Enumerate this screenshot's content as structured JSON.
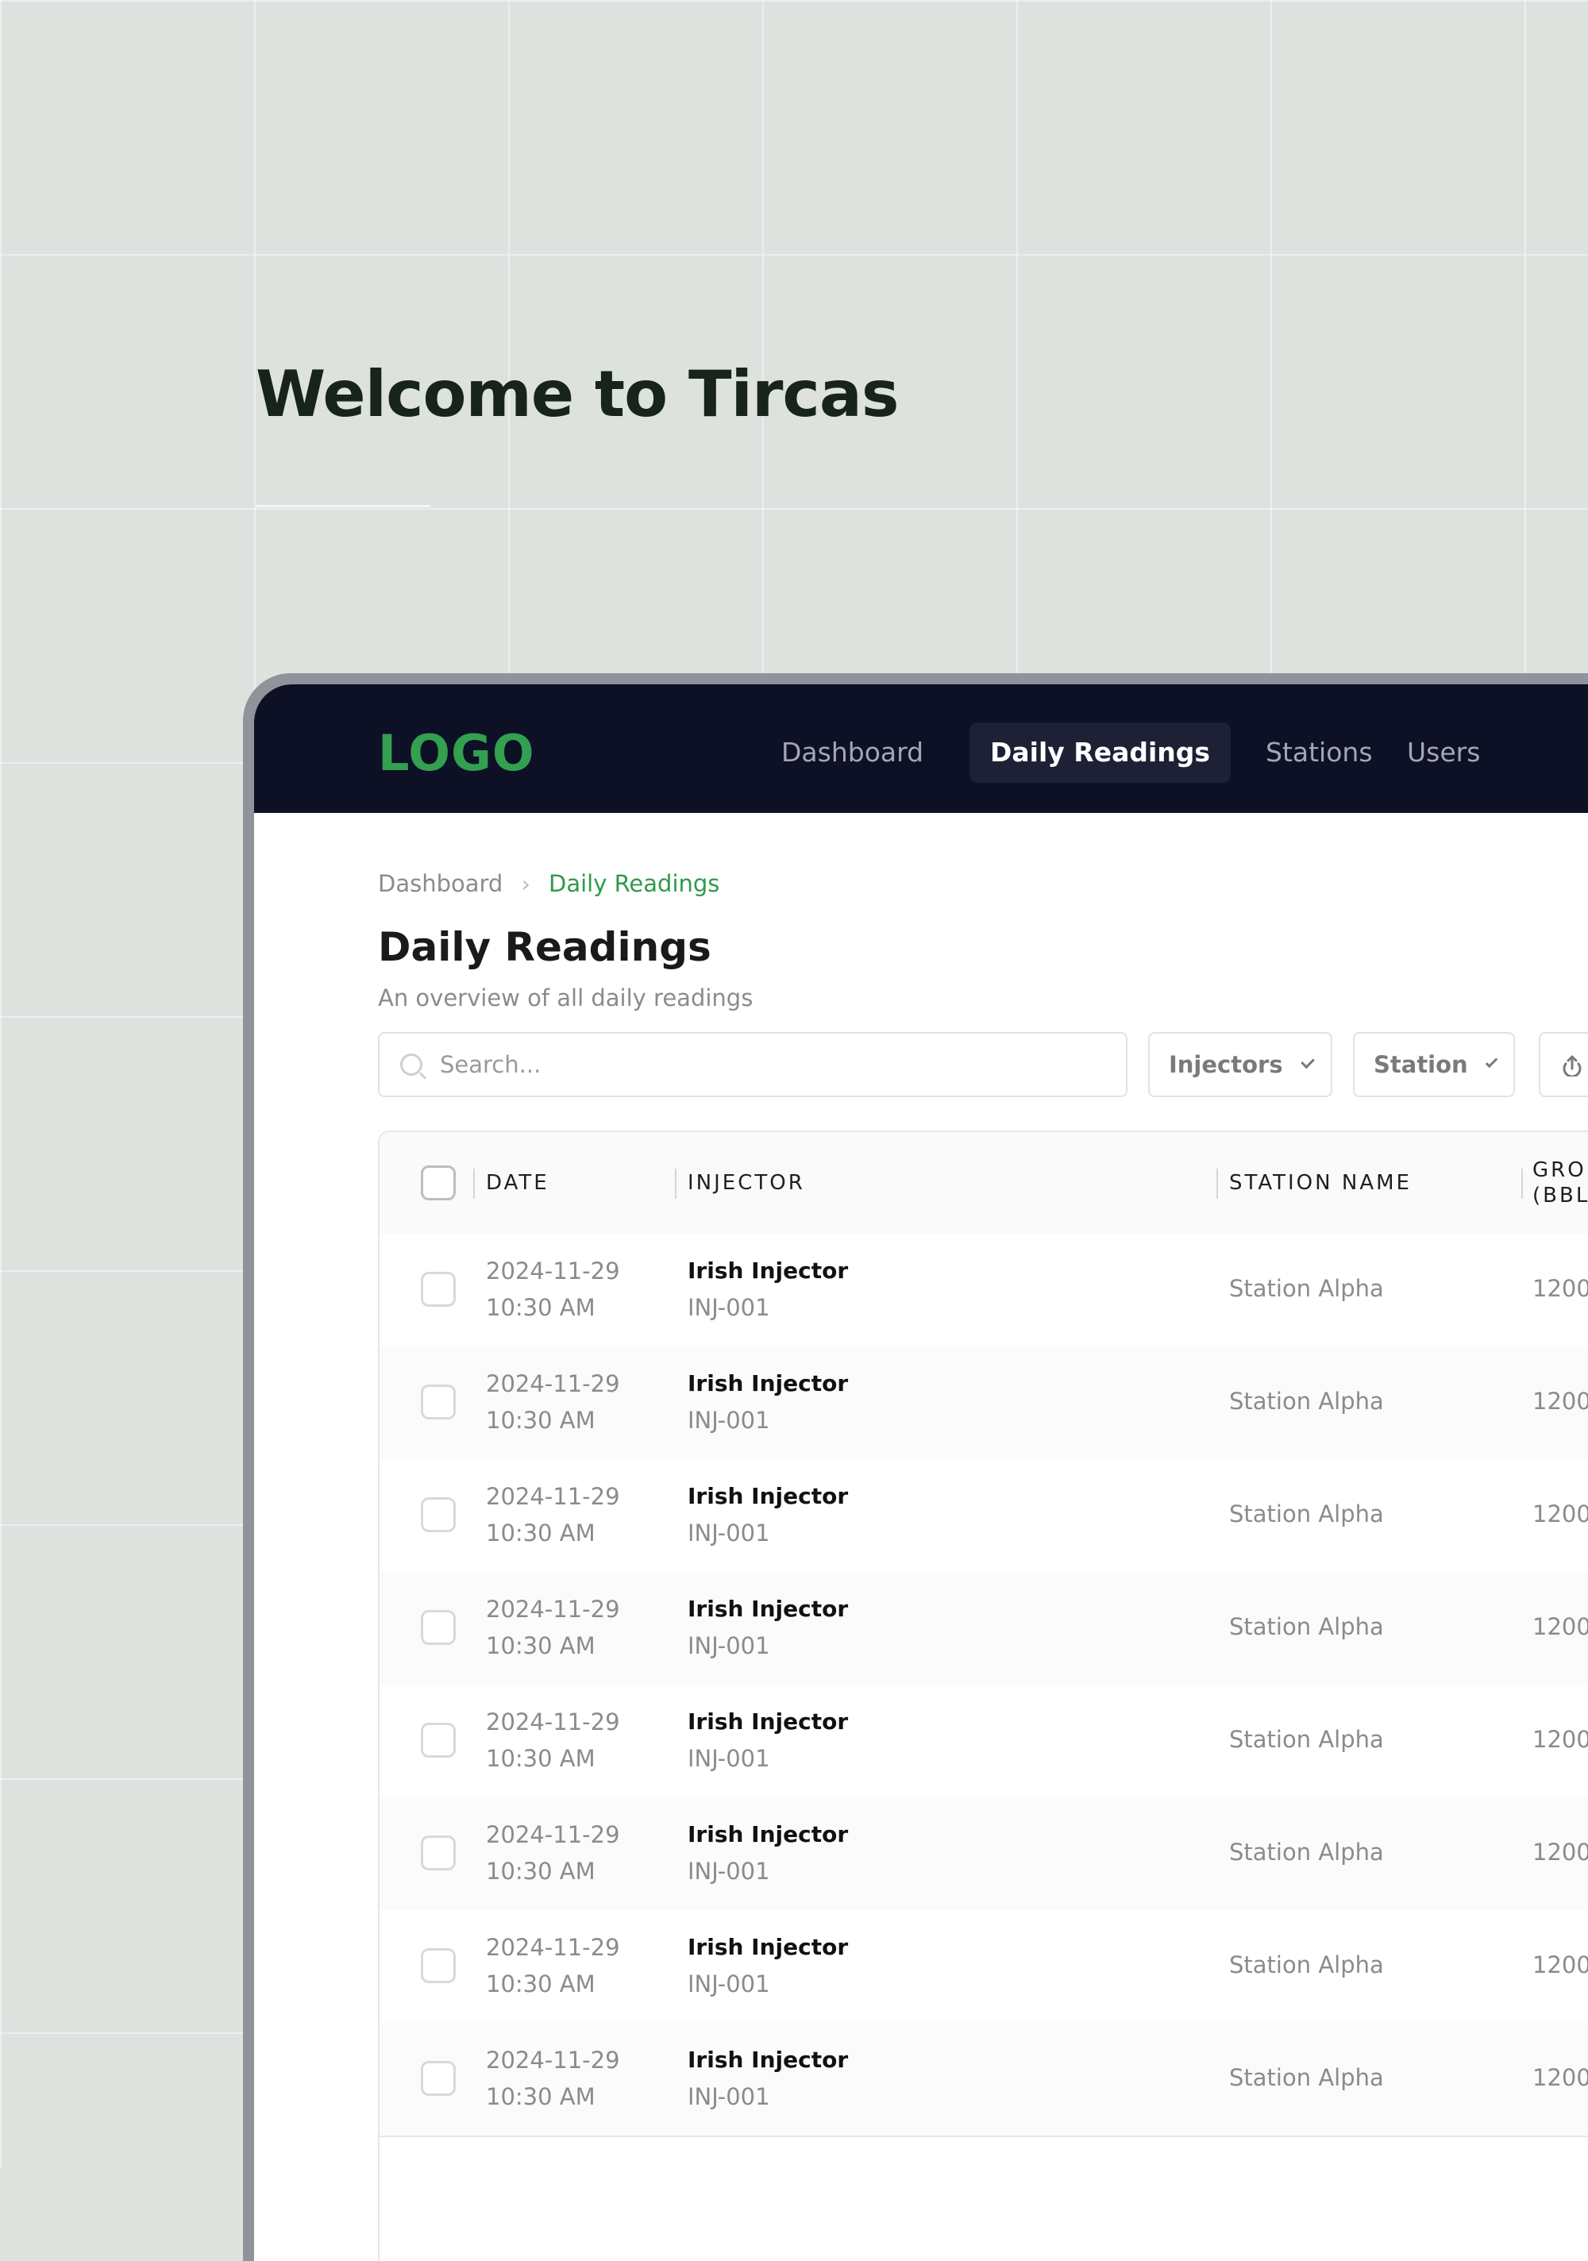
{
  "hero": {
    "title": "Welcome to Tircas"
  },
  "app": {
    "logo": "LOGO",
    "nav": [
      {
        "label": "Dashboard",
        "active": false
      },
      {
        "label": "Daily Readings",
        "active": true
      },
      {
        "label": "Stations",
        "active": false
      },
      {
        "label": "Users",
        "active": false
      }
    ],
    "breadcrumb": {
      "parent": "Dashboard",
      "current": "Daily Readings"
    },
    "page": {
      "title": "Daily Readings",
      "subtitle": "An overview of all daily readings"
    },
    "toolbar": {
      "search_placeholder": "Search...",
      "filters": [
        "Injectors",
        "Station"
      ],
      "export_icon": "export-icon"
    },
    "table": {
      "columns": [
        "DATE",
        "INJECTOR",
        "STATION NAME",
        "GRO",
        "(BBL"
      ],
      "rows": [
        {
          "date": "2024-11-29",
          "time": "10:30 AM",
          "injector": "Irish Injector",
          "injector_id": "INJ-001",
          "station": "Station Alpha",
          "gross": "1200"
        },
        {
          "date": "2024-11-29",
          "time": "10:30 AM",
          "injector": "Irish Injector",
          "injector_id": "INJ-001",
          "station": "Station Alpha",
          "gross": "1200"
        },
        {
          "date": "2024-11-29",
          "time": "10:30 AM",
          "injector": "Irish Injector",
          "injector_id": "INJ-001",
          "station": "Station Alpha",
          "gross": "1200"
        },
        {
          "date": "2024-11-29",
          "time": "10:30 AM",
          "injector": "Irish Injector",
          "injector_id": "INJ-001",
          "station": "Station Alpha",
          "gross": "1200"
        },
        {
          "date": "2024-11-29",
          "time": "10:30 AM",
          "injector": "Irish Injector",
          "injector_id": "INJ-001",
          "station": "Station Alpha",
          "gross": "1200"
        },
        {
          "date": "2024-11-29",
          "time": "10:30 AM",
          "injector": "Irish Injector",
          "injector_id": "INJ-001",
          "station": "Station Alpha",
          "gross": "1200"
        },
        {
          "date": "2024-11-29",
          "time": "10:30 AM",
          "injector": "Irish Injector",
          "injector_id": "INJ-001",
          "station": "Station Alpha",
          "gross": "1200"
        },
        {
          "date": "2024-11-29",
          "time": "10:30 AM",
          "injector": "Irish Injector",
          "injector_id": "INJ-001",
          "station": "Station Alpha",
          "gross": "1200"
        }
      ]
    },
    "colors": {
      "background": "#dde2de",
      "navbar": "#0e1026",
      "accent_green": "#33a050",
      "frame": "#8f939a"
    }
  }
}
